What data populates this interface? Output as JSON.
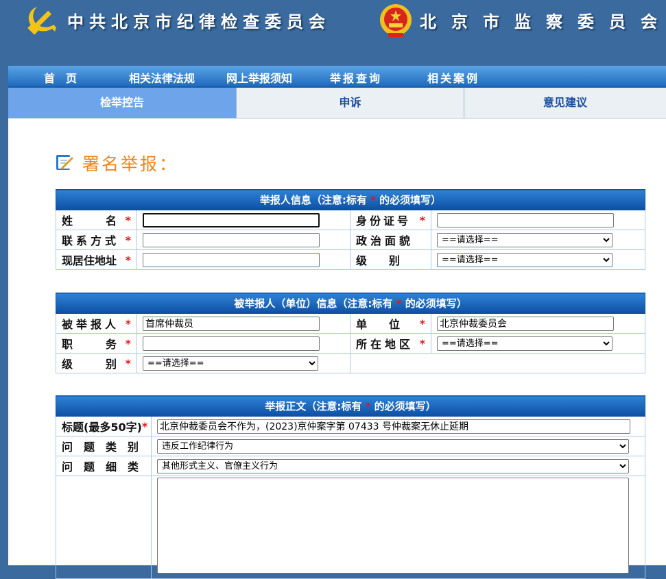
{
  "header": {
    "title_left": "中共北京市纪律检查委员会",
    "title_right": "北京市监察委员会"
  },
  "nav": {
    "items": [
      "首　页",
      "相关法律法规",
      "网上举报须知",
      "举报查询",
      "相关案例"
    ]
  },
  "tabs": [
    "检举控告",
    "申诉",
    "意见建议"
  ],
  "section_title": "署名举报：",
  "required_mark": "*",
  "reporter": {
    "caption_pre": "举报人信息（注意:标有",
    "caption_post": "的必须填写）",
    "name_label": "姓　　　名",
    "id_label": "身份证号",
    "contact_label": "联系方式",
    "political_label": "政治面貌",
    "address_label": "现居住地址",
    "level_label": "级　　别",
    "political_value": "==请选择==",
    "level_value": "==请选择=="
  },
  "reported": {
    "caption_pre": "被举报人（单位）信息（注意:标有",
    "caption_post": "的必须填写）",
    "person_label": "被举报人",
    "person_value": "首席仲裁员",
    "unit_label": "单　　位",
    "unit_value": "北京仲裁委员会",
    "position_label": "职　　　务",
    "region_label": "所在地区",
    "region_value": "==请选择==",
    "level_label": "级　　　别",
    "level_value": "==请选择=="
  },
  "content": {
    "caption_pre": "举报正文（注意:标有",
    "caption_post": "的必须填写）",
    "title_label": "标题(最多50字)",
    "title_value": "北京仲裁委员会不作为，(2023)京仲案字第 07433 号仲裁案无休止延期",
    "category_label": "问　题　类　别",
    "category_value": "违反工作纪律行为",
    "detail_label": "问　题　细　类",
    "detail_value": "其他形式主义、官僚主义行为"
  },
  "colors": {
    "header_bg": "#3a6a9e",
    "accent_orange": "#f08319",
    "required_red": "#e01919",
    "caption_blue": "#0d4fa3",
    "active_tab": "#6ea4ea"
  }
}
